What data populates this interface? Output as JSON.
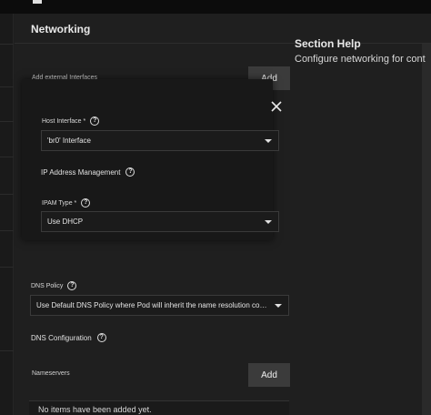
{
  "page": {
    "title": "Networking"
  },
  "section_help": {
    "title": "Section Help",
    "text": "Configure networking for cont"
  },
  "external_interfaces": {
    "label": "Add external Interfaces",
    "add_label": "Add",
    "card": {
      "host_interface": {
        "label": "Host Interface *",
        "value": "'br0' Interface"
      },
      "ip_management_title": "IP Address Management",
      "ipam_type": {
        "label": "IPAM Type *",
        "value": "Use DHCP"
      }
    }
  },
  "dns_policy": {
    "label": "DNS Policy",
    "value": "Use Default DNS Policy where Pod will inherit the name resolution configuration from the node."
  },
  "dns_configuration": {
    "title": "DNS Configuration",
    "nameservers_label": "Nameservers",
    "add_label": "Add",
    "empty_text": "No items have been added yet."
  },
  "icons": {
    "help": "question-circle-icon",
    "close": "close-icon",
    "caret": "caret-down-icon",
    "menu": "menu-icon"
  },
  "colors": {
    "background": "#1f1f1f",
    "button": "#3b3b3b",
    "card": "#181818"
  }
}
